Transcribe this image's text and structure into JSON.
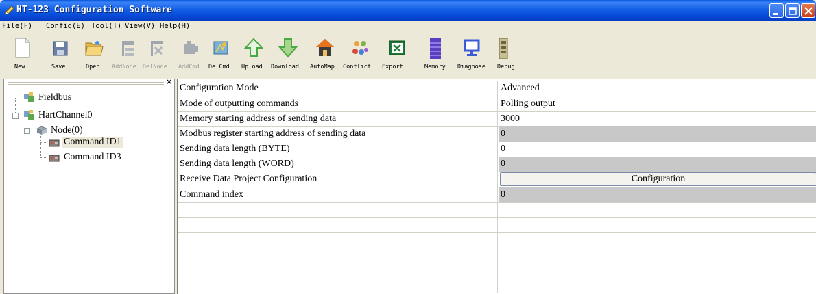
{
  "window": {
    "title": "HT-123 Configuration Software"
  },
  "menu": [
    {
      "label": "File(F)"
    },
    {
      "label": "Config(E)"
    },
    {
      "label": "Tool(T)"
    },
    {
      "label": "View(V)"
    },
    {
      "label": "Help(H)"
    }
  ],
  "toolbar": [
    {
      "label": "New",
      "icon": "new-file-icon",
      "enabled": true
    },
    {
      "label": "Save",
      "icon": "save-icon",
      "enabled": true
    },
    {
      "label": "Open",
      "icon": "open-folder-icon",
      "enabled": true
    },
    {
      "label": "AddNode",
      "icon": "add-node-icon",
      "enabled": false
    },
    {
      "label": "DelNode",
      "icon": "delete-node-icon",
      "enabled": false
    },
    {
      "label": "AddCmd",
      "icon": "add-command-icon",
      "enabled": false
    },
    {
      "label": "DelCmd",
      "icon": "delete-command-icon",
      "enabled": true
    },
    {
      "label": "Upload",
      "icon": "upload-arrow-icon",
      "enabled": true
    },
    {
      "label": "Download",
      "icon": "download-arrow-icon",
      "enabled": true
    },
    {
      "label": "AutoMap",
      "icon": "home-icon",
      "enabled": true
    },
    {
      "label": "Conflict",
      "icon": "conflict-icon",
      "enabled": true
    },
    {
      "label": "Export",
      "icon": "excel-export-icon",
      "enabled": true
    },
    {
      "label": "Memory",
      "icon": "memory-icon",
      "enabled": true
    },
    {
      "label": "Diagnose",
      "icon": "diagnose-icon",
      "enabled": true
    },
    {
      "label": "Debug",
      "icon": "debug-icon",
      "enabled": true
    }
  ],
  "tree": {
    "close_label": "×",
    "items": [
      {
        "label": "Fieldbus",
        "icon": "fieldbus-icon"
      },
      {
        "label": "HartChannel0",
        "icon": "channel-icon"
      },
      {
        "label": "Node(0)",
        "icon": "node-icon"
      },
      {
        "label": "Command ID1",
        "icon": "command-icon",
        "selected": true
      },
      {
        "label": "Command ID3",
        "icon": "command-icon"
      }
    ]
  },
  "properties": [
    {
      "name": "Configuration Mode",
      "value": "Advanced",
      "readonly": false
    },
    {
      "name": "Mode of outputting commands",
      "value": "Polling output",
      "readonly": false
    },
    {
      "name": "Memory starting address of sending data",
      "value": "3000",
      "readonly": false
    },
    {
      "name": "Modbus register starting address of sending data",
      "value": "0",
      "readonly": true
    },
    {
      "name": "Sending data length (BYTE)",
      "value": "0",
      "readonly": false
    },
    {
      "name": "Sending data length (WORD)",
      "value": "0",
      "readonly": true
    },
    {
      "name": "Receive Data Project Configuration",
      "button": "Configuration"
    },
    {
      "name": "Command index",
      "value": "0",
      "readonly": true
    }
  ],
  "colors": {
    "titlebar": "#0a5ae0",
    "readonly_cell": "#c8c8c8",
    "chrome": "#ece9d8"
  }
}
